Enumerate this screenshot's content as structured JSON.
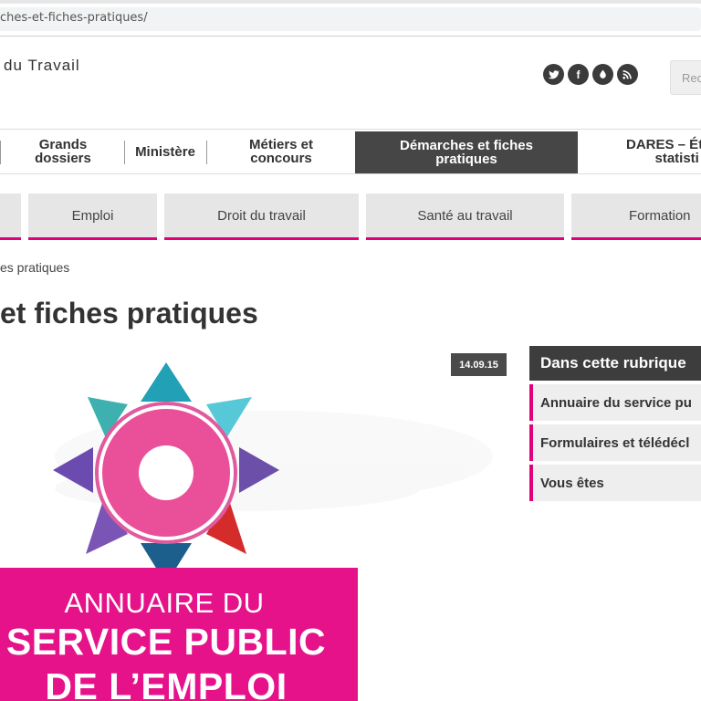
{
  "browser": {
    "url": "ches-et-fiches-pratiques/"
  },
  "header": {
    "site_name": "du Travail",
    "search_placeholder": "Rec",
    "social": [
      {
        "name": "twitter",
        "label": ""
      },
      {
        "name": "facebook",
        "label": "f"
      },
      {
        "name": "flickr",
        "label": ""
      },
      {
        "name": "rss",
        "label": ""
      }
    ]
  },
  "mainnav": {
    "items": [
      {
        "label_1": "Grands",
        "label_2": "dossiers"
      },
      {
        "label_1": "Ministère",
        "label_2": ""
      },
      {
        "label_1": "Métiers et",
        "label_2": "concours"
      },
      {
        "label_1": "Démarches et fiches",
        "label_2": "pratiques"
      },
      {
        "label_1": "DARES – Étu",
        "label_2": "statisti"
      }
    ]
  },
  "subnav": {
    "items": [
      "Emploi",
      "Droit du travail",
      "Santé au travail",
      "Formation"
    ]
  },
  "breadcrumb": "es pratiques",
  "page_title": "et fiches pratiques",
  "article": {
    "date": "14.09.15",
    "banner_line_1": "ANNUAIRE DU",
    "banner_line_2": "SERVICE PUBLIC",
    "banner_line_3": "DE L’EMPLOI"
  },
  "sidebar": {
    "heading": "Dans cette rubrique",
    "items": [
      "Annuaire du service pu",
      "Formulaires et télédécl",
      "Vous êtes"
    ]
  },
  "colors": {
    "accent": "#e2007a",
    "nav_active": "#464646",
    "banner": "#e5128a"
  }
}
